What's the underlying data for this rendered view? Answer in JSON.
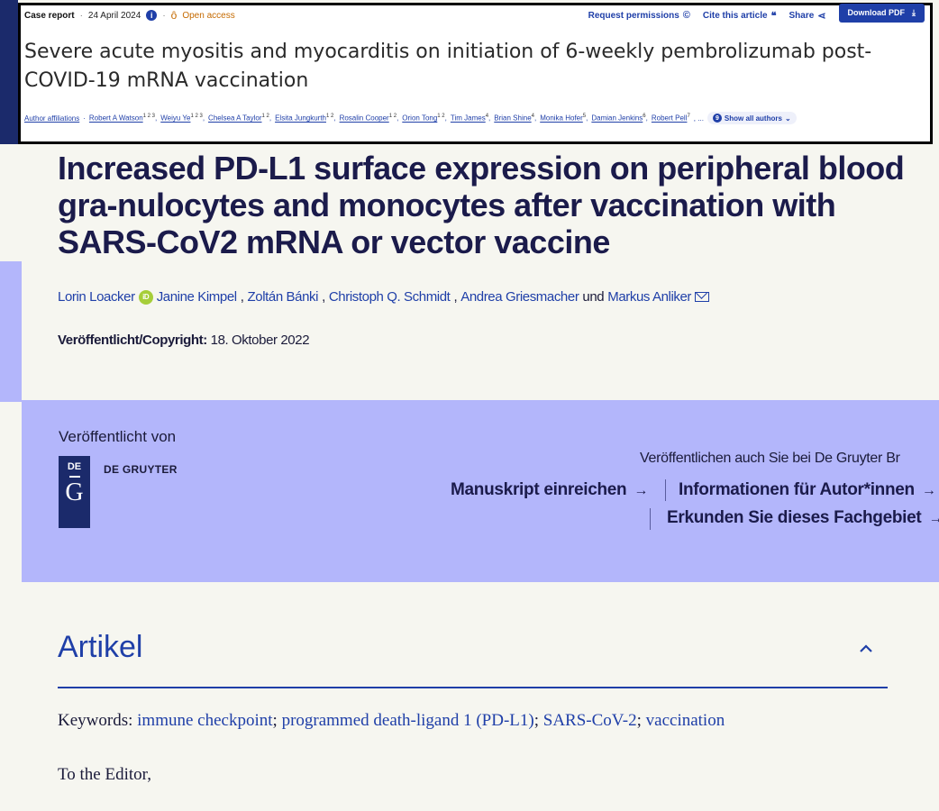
{
  "overlay": {
    "type": "Case report",
    "date": "24 April 2024",
    "open_access": "Open access",
    "request_permissions": "Request permissions",
    "cite": "Cite this article",
    "share": "Share",
    "download_pdf": "Download PDF",
    "title": "Severe acute myositis and myocarditis on initiation of 6-weekly pembrolizumab post-COVID-19 mRNA vaccination",
    "author_affiliations": "Author affiliations",
    "authors": [
      {
        "name": "Robert A Watson",
        "sup": "1 2 3"
      },
      {
        "name": "Weiyu Ye",
        "sup": "1 2 3"
      },
      {
        "name": "Chelsea A Taylor",
        "sup": "1 2"
      },
      {
        "name": "Elsita Jungkurth",
        "sup": "1 2"
      },
      {
        "name": "Rosalin Cooper",
        "sup": "1 2"
      },
      {
        "name": "Orion Tong",
        "sup": "1 2"
      },
      {
        "name": "Tim James",
        "sup": "4"
      },
      {
        "name": "Brian Shine",
        "sup": "4"
      },
      {
        "name": "Monika Hofer",
        "sup": "5"
      },
      {
        "name": "Damian Jenkins",
        "sup": "6"
      },
      {
        "name": "Robert Pell",
        "sup": "7"
      }
    ],
    "ellipsis": ", ...",
    "show_all_count": "9",
    "show_all": "Show all authors"
  },
  "article": {
    "title": "Increased PD-L1 surface expression on peripheral blood gra-nulocytes and monocytes after vaccination with SARS-CoV2 mRNA or vector vaccine",
    "authors": [
      "Lorin Loacker",
      "Janine Kimpel",
      "Zoltán Bánki",
      "Christoph Q. Schmidt",
      "Andrea Griesmacher"
    ],
    "and": "und",
    "last_author": "Markus Anliker",
    "published_label": "Veröffentlicht/Copyright:",
    "published_date": "18. Oktober 2022"
  },
  "publisher": {
    "by_label": "Veröffentlicht von",
    "logo_de": "DE",
    "logo_g": "G",
    "name": "DE GRUYTER",
    "also": "Veröffentlichen auch Sie bei De Gruyter Br",
    "submit": "Manuskript einreichen",
    "info": "Informationen für Autor*innen",
    "explore": "Erkunden Sie dieses Fachgebiet"
  },
  "section": {
    "heading": "Artikel",
    "keywords_label": "Keywords:",
    "keywords": [
      "immune checkpoint",
      "programmed death-ligand 1 (PD-L1)",
      "SARS-CoV-2",
      "vaccination"
    ],
    "salutation": "To the Editor,"
  }
}
